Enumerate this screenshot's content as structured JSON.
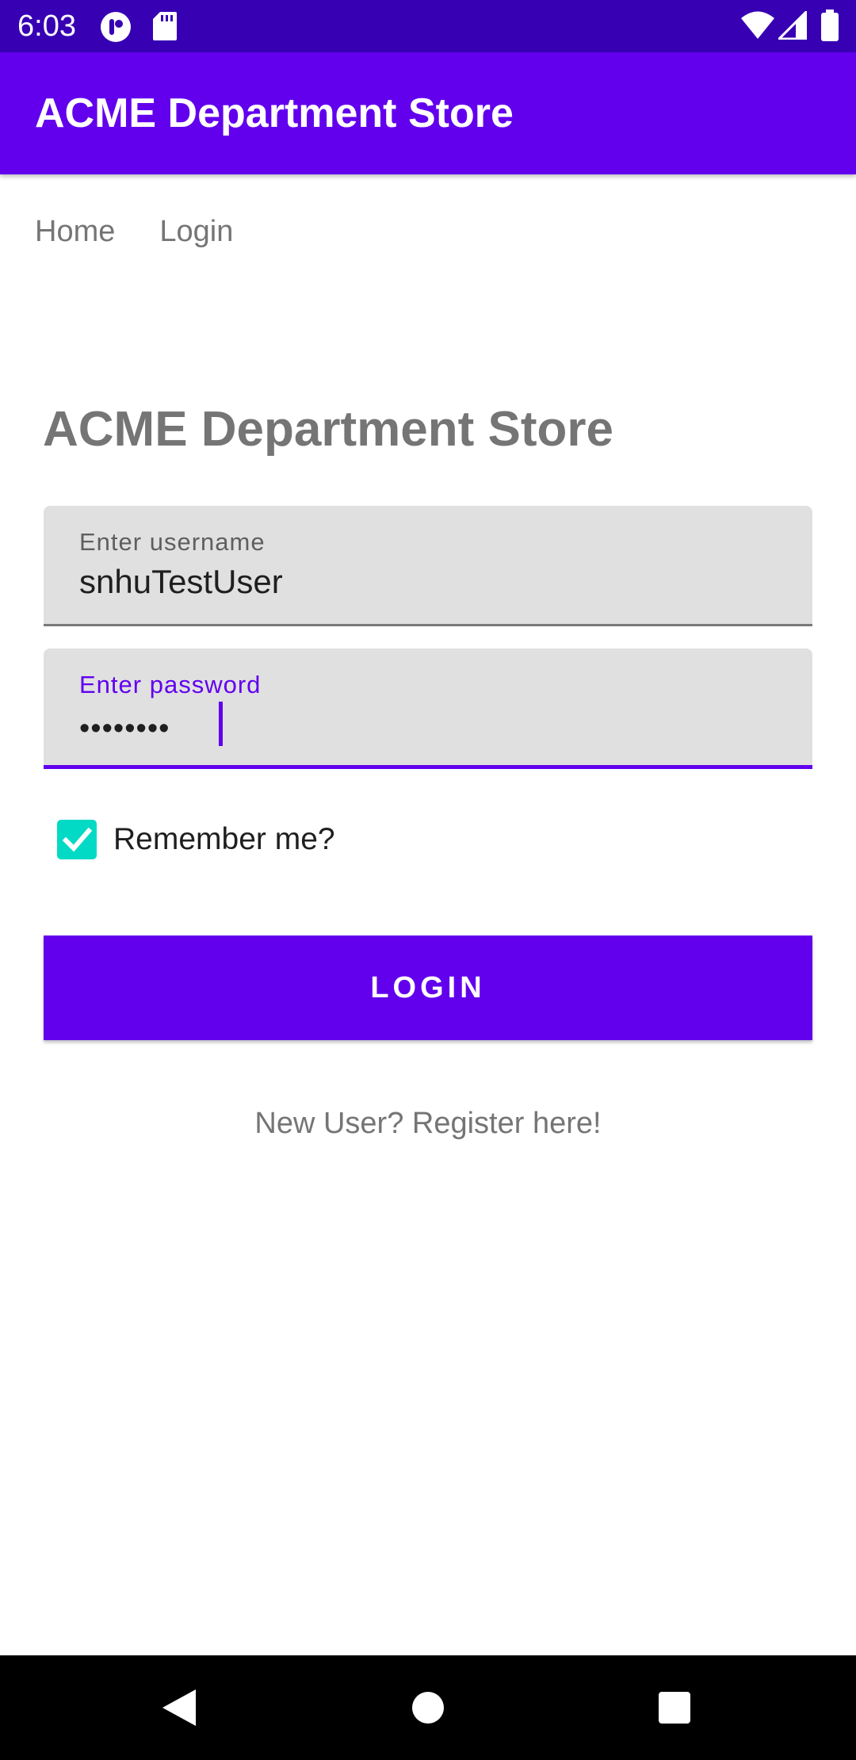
{
  "status_bar": {
    "time": "6:03",
    "icons": [
      "notification-app-icon",
      "sd-card-icon",
      "wifi-icon",
      "signal-icon",
      "battery-icon"
    ]
  },
  "app_bar": {
    "title": "ACME Department Store"
  },
  "nav": {
    "items": [
      {
        "label": "Home"
      },
      {
        "label": "Login"
      }
    ]
  },
  "page": {
    "heading": "ACME Department Store"
  },
  "username_field": {
    "label": "Enter username",
    "value": "snhuTestUser"
  },
  "password_field": {
    "label": "Enter password",
    "value": "••••••••",
    "focused": true
  },
  "remember": {
    "label": "Remember me?",
    "checked": true
  },
  "login_button": {
    "label": "LOGIN"
  },
  "register_link": {
    "label": "New User? Register here!"
  },
  "navigation_bar": {
    "icons": [
      "back-icon",
      "home-icon",
      "recents-icon"
    ]
  },
  "colors": {
    "primary": "#6200ee",
    "primary_dark": "#3700b3",
    "accent": "#03dac5",
    "muted_text": "#757575",
    "field_background": "#e0e0e0"
  }
}
